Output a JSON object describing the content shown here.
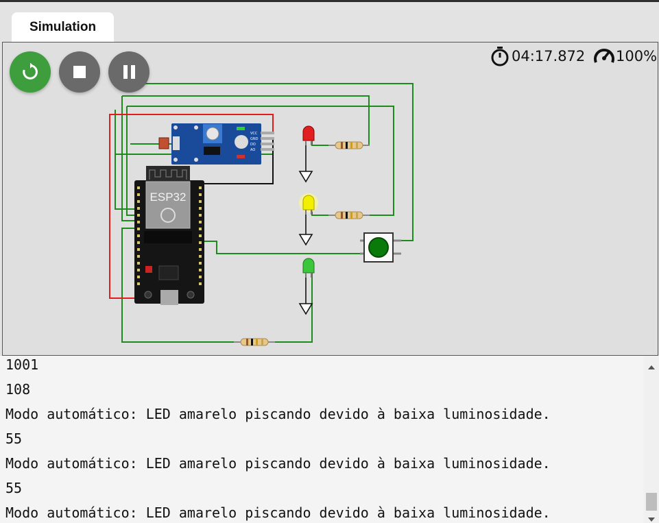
{
  "tab": {
    "label": "Simulation"
  },
  "controls": {
    "restart": {
      "label": "Restart",
      "icon": "restart-icon",
      "color": "#3e9e3e"
    },
    "stop": {
      "label": "Stop",
      "icon": "stop-icon",
      "color": "#6a6a6a"
    },
    "pause": {
      "label": "Pause",
      "icon": "pause-icon",
      "color": "#6a6a6a"
    }
  },
  "status": {
    "time": "04:17.872",
    "speed": "100%",
    "time_icon": "stopwatch-icon",
    "speed_icon": "speedometer-icon"
  },
  "circuit": {
    "mcu_label": "ESP32",
    "sensor_labels": [
      "VCC",
      "GND",
      "DO",
      "AO"
    ],
    "led_colors": {
      "red": "#e02020",
      "yellow": "#f2f000",
      "green": "#3cc63c"
    }
  },
  "serial": {
    "lines": [
      "1001",
      "108",
      "Modo automático: LED amarelo piscando devido à baixa luminosidade.",
      "55",
      "Modo automático: LED amarelo piscando devido à baixa luminosidade.",
      "55",
      "Modo automático: LED amarelo piscando devido à baixa luminosidade."
    ]
  }
}
